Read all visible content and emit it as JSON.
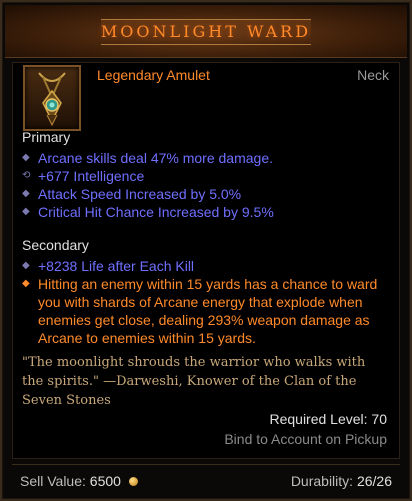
{
  "item": {
    "name": "MOONLIGHT WARD",
    "type": "Legendary Amulet",
    "slot": "Neck",
    "icon": "amulet-icon"
  },
  "primary": {
    "title": "Primary",
    "affixes": [
      {
        "text": "Arcane skills deal 47% more damage.",
        "bullet": "◆"
      },
      {
        "text": "+677 Intelligence",
        "bullet": "⟲"
      },
      {
        "text": "Attack Speed Increased by 5.0%",
        "bullet": "◆"
      },
      {
        "text": "Critical Hit Chance Increased by 9.5%",
        "bullet": "◆"
      }
    ]
  },
  "secondary": {
    "title": "Secondary",
    "affixes": [
      {
        "text": "+8238 Life after Each Kill",
        "bullet": "◆"
      },
      {
        "text": "Hitting an enemy within 15 yards has a chance to ward you with shards of Arcane energy that explode when enemies get close, dealing 293% weapon damage as Arcane to enemies within 15 yards.",
        "bullet": "◆"
      }
    ]
  },
  "flavor": "\"The moonlight shrouds the warrior who walks with the spirits.\" —Darweshi, Knower of the Clan of the Seven Stones",
  "requirements": {
    "level": "Required Level: 70",
    "bind": "Bind to Account on Pickup"
  },
  "footer": {
    "sell_label": "Sell Value:",
    "sell_value": "6500",
    "durability_label": "Durability:",
    "durability_value": "26/26"
  },
  "colors": {
    "legendary": "#ff8a2a",
    "magic": "#6f6fff",
    "flavor": "#c8a87a"
  }
}
